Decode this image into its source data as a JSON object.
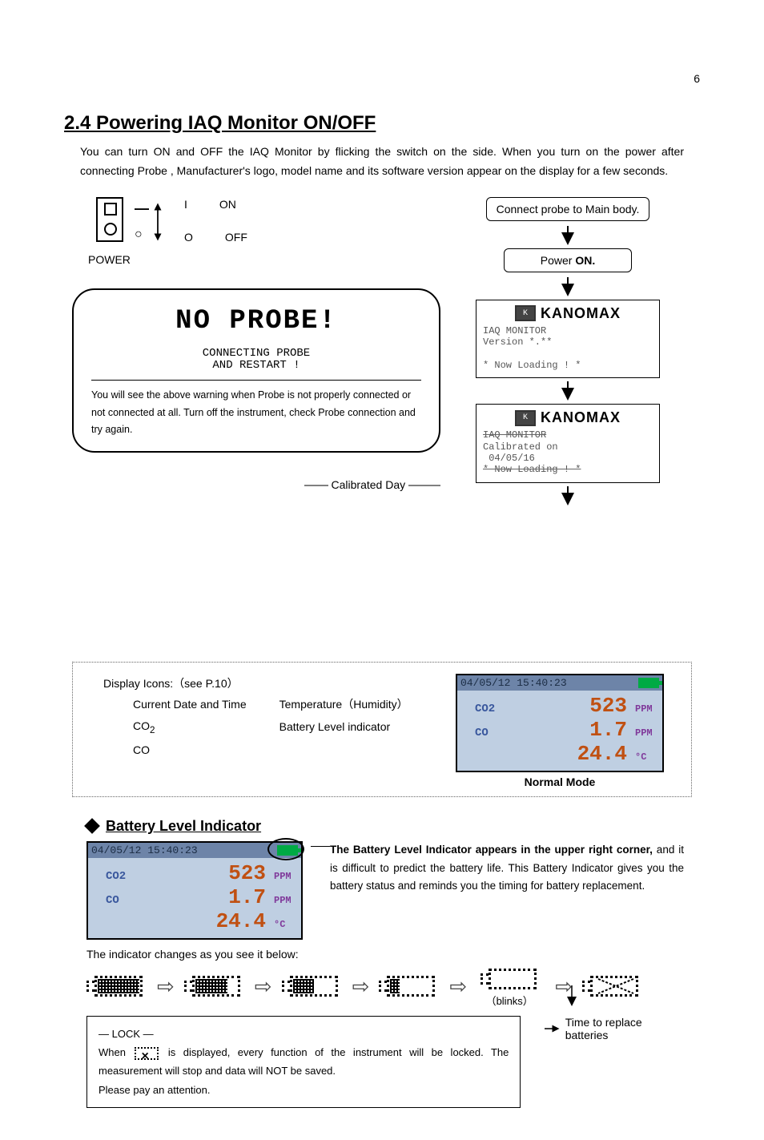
{
  "page_number": "6",
  "section_title": "2.4 Powering IAQ Monitor ON/OFF",
  "intro_text": "You can turn ON and OFF the IAQ Monitor by flicking the switch on the side.   When you turn on the power after connecting Probe , Manufacturer's logo, model name and its software version appear on the display for a few seconds.",
  "switch": {
    "i_mark": "I",
    "o_mark": "O",
    "on_label": "ON",
    "off_label": "OFF",
    "power_label": "POWER"
  },
  "noprobe": {
    "big": "NO PROBE!",
    "small1": "CONNECTING PROBE",
    "small2": "AND RESTART !",
    "note": "You will see the above warning when Probe is not properly connected or not connected at all.   Turn off the instrument, check Probe connection and try again."
  },
  "calibrated_label": "Calibrated Day",
  "flow": {
    "box1": "Connect probe to Main body.",
    "box2_pre": "Power ",
    "box2_bold": "ON."
  },
  "screen1": {
    "brand": "KANOMAX",
    "l1": "IAQ MONITOR",
    "l2": "Version *.**",
    "l3": "* Now Loading ! *"
  },
  "screen2": {
    "brand": "KANOMAX",
    "l1": "IAQ MONITOR",
    "l2": "Calibrated on",
    "l3": " 04/05/16",
    "l4": "* Now Loading ! *"
  },
  "normal": {
    "datetime": "04/05/12 15:40:23",
    "co2_label": "CO2",
    "co2_val": "523",
    "co2_unit": "PPM",
    "co_label": "CO",
    "co_val": "1.7",
    "co_unit": "PPM",
    "temp_val": "24.4",
    "temp_unit": "°C",
    "caption": "Normal Mode"
  },
  "icons_legend": {
    "title": "Display Icons:（see P.10）",
    "l1": "Current Date and Time",
    "l2": "CO",
    "l2_sub": "2",
    "l3": "CO",
    "r1": "Temperature（Humidity）",
    "r2": "Battery Level indicator"
  },
  "battery_section": {
    "header": "Battery Level Indicator",
    "desc_bold": "The Battery Level Indicator appears in the upper right corner,",
    "desc_rest": " and it is difficult to predict the battery life. This  Battery Indicator  gives you the battery status and reminds you the timing for battery replacement.",
    "changes_line": "The indicator changes as you see it below:",
    "blinks_label": "（blinks）",
    "time_replace": "Time to replace batteries"
  },
  "lock_box": {
    "title": "― LOCK ―",
    "body_pre": "When ",
    "body_post": " is displayed, every function of the instrument will be locked.   The measurement will stop and data will NOT be saved.",
    "body_last": "Please pay an attention."
  }
}
